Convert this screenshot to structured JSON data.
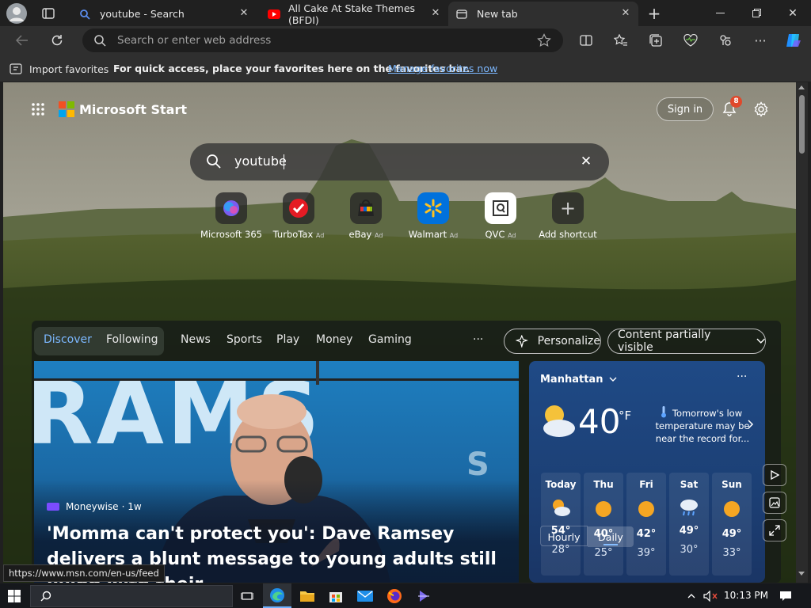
{
  "tabs": [
    {
      "title": "youtube - Search",
      "favicon": "search-icon"
    },
    {
      "title": "All Cake At Stake Themes (BFDI)",
      "favicon": "youtube-icon"
    },
    {
      "title": "New tab",
      "favicon": "newtab-icon",
      "active": true
    }
  ],
  "address": {
    "placeholder": "Search or enter web address"
  },
  "favorites_bar": {
    "import_label": "Import favorites",
    "hint": "For quick access, place your favorites here on the favorites bar.",
    "manage_link": "Manage favorites now"
  },
  "ms_start": {
    "brand": "Microsoft Start",
    "sign_in": "Sign in",
    "notification_count": "8",
    "search_value": "youtube"
  },
  "shortcuts": [
    {
      "label": "Microsoft 365",
      "ad": ""
    },
    {
      "label": "TurboTax",
      "ad": "Ad"
    },
    {
      "label": "eBay",
      "ad": "Ad"
    },
    {
      "label": "Walmart",
      "ad": "Ad"
    },
    {
      "label": "QVC",
      "ad": "Ad"
    },
    {
      "label": "Add shortcut",
      "ad": ""
    }
  ],
  "feed_nav": {
    "tabs": [
      "Discover",
      "Following",
      "News",
      "Sports",
      "Play",
      "Money",
      "Gaming"
    ],
    "more": "···",
    "personalize": "Personalize",
    "content_visibility": "Content partially visible"
  },
  "hero": {
    "source": "Moneywise",
    "age": "· 1w",
    "headline": "'Momma can't protect you': Dave Ramsey delivers a blunt message to young adults still living with their...",
    "bg_text": "RAMS",
    "bg_text_s": "S"
  },
  "weather": {
    "location": "Manhattan",
    "temp": "40",
    "unit": "°F",
    "alert": "Tomorrow's low temperature may be near the record for...",
    "toggle": [
      "Hourly",
      "Daily"
    ],
    "days": [
      {
        "name": "Today",
        "hi": "54°",
        "lo": "28°",
        "icon": "partly-cloudy-icon"
      },
      {
        "name": "Thu",
        "hi": "40°",
        "lo": "25°",
        "icon": "sunny-icon"
      },
      {
        "name": "Fri",
        "hi": "42°",
        "lo": "39°",
        "icon": "sunny-icon"
      },
      {
        "name": "Sat",
        "hi": "49°",
        "lo": "30°",
        "icon": "rain-icon"
      },
      {
        "name": "Sun",
        "hi": "49°",
        "lo": "33°",
        "icon": "sunny-icon"
      }
    ]
  },
  "status_url": "https://www.msn.com/en-us/feed",
  "clock": "10:13 PM",
  "colors": {
    "accent": "#3a8ee6",
    "link": "#7cb8ff",
    "notification": "#e0482b"
  }
}
